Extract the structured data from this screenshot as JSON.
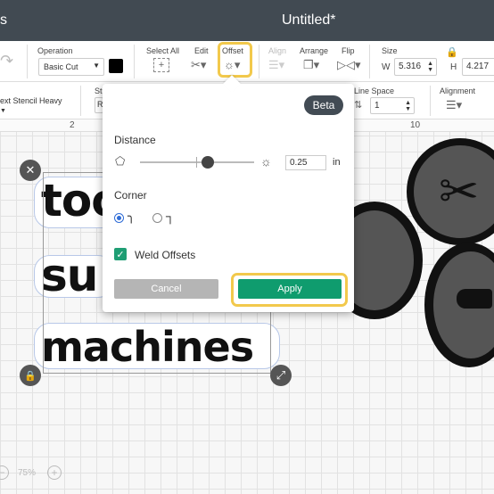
{
  "titlebar": {
    "left_text": "s",
    "title": "Untitled*"
  },
  "toolbar": {
    "operation_label": "Operation",
    "operation_value": "Basic Cut",
    "select_all_label": "Select All",
    "edit_label": "Edit",
    "offset_label": "Offset",
    "align_label": "Align",
    "arrange_label": "Arrange",
    "flip_label": "Flip",
    "size_label": "Size",
    "width_prefix": "W",
    "width_value": "5.316",
    "height_prefix": "H",
    "height_value": "4.217"
  },
  "text_toolbar": {
    "font_value": "ext Stencil Heavy",
    "style_label": "St",
    "style_value": "R",
    "line_space_label": "Line Space",
    "line_space_value": "1",
    "alignment_label": "Alignment"
  },
  "ruler": {
    "mark_2": "2",
    "mark_10": "10"
  },
  "canvas": {
    "words": [
      "too",
      "su",
      "machines"
    ],
    "zoom_value": "75%"
  },
  "offset_panel": {
    "badge": "Beta",
    "distance_label": "Distance",
    "distance_value": "0.25",
    "distance_unit": "in",
    "corner_label": "Corner",
    "corner_selected": "rounded",
    "weld_label": "Weld Offsets",
    "weld_checked": true,
    "cancel_label": "Cancel",
    "apply_label": "Apply"
  },
  "colors": {
    "titlebar": "#414a52",
    "apply": "#0f9c6e",
    "highlight": "#f2c94c"
  }
}
